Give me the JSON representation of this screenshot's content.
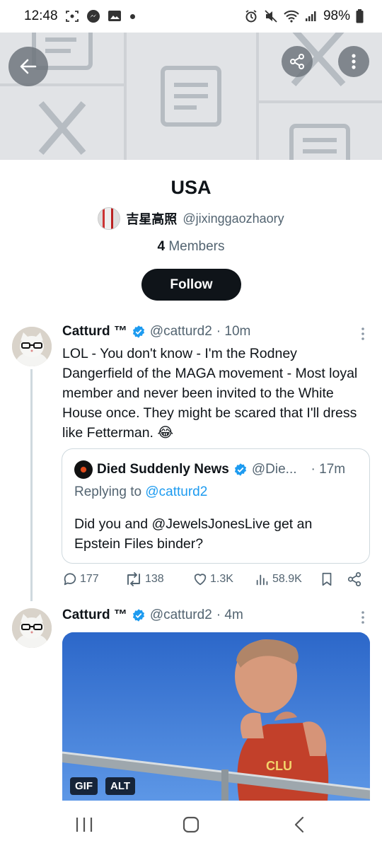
{
  "status_bar": {
    "time": "12:48",
    "battery": "98%"
  },
  "banner": {
    "back_icon": "arrow-left-icon",
    "share_icon": "share-icon",
    "more_icon": "more-vertical-icon"
  },
  "list": {
    "title": "USA",
    "owner_name": "吉星高照",
    "owner_handle": "@jixinggaozhaory",
    "member_count": "4",
    "members_label": "Members",
    "follow_label": "Follow"
  },
  "tweets": [
    {
      "author": "Catturd ™",
      "handle": "@catturd2",
      "time": "· 10m",
      "text": "LOL - You don't know - I'm the Rodney Dangerfield of the MAGA movement - Most loyal member and never been invited to the White House once.  They might be scared that I'll dress like Fetterman. 😂",
      "quote": {
        "author": "Died Suddenly News",
        "handle": "@Die...",
        "time": "· 17m",
        "replying_prefix": "Replying to",
        "replying_to": "@catturd2",
        "text": "Did you and @JewelsJonesLive get an Epstein Files binder?"
      },
      "stats": {
        "replies": "177",
        "retweets": "138",
        "likes": "1.3K",
        "views": "58.9K"
      }
    },
    {
      "author": "Catturd ™",
      "handle": "@catturd2",
      "time": "· 4m",
      "media_badges": [
        "GIF",
        "ALT"
      ]
    }
  ],
  "colors": {
    "accent": "#1d9bf0",
    "text": "#0f1419",
    "muted": "#536471",
    "follow_bg": "#0f1419"
  }
}
